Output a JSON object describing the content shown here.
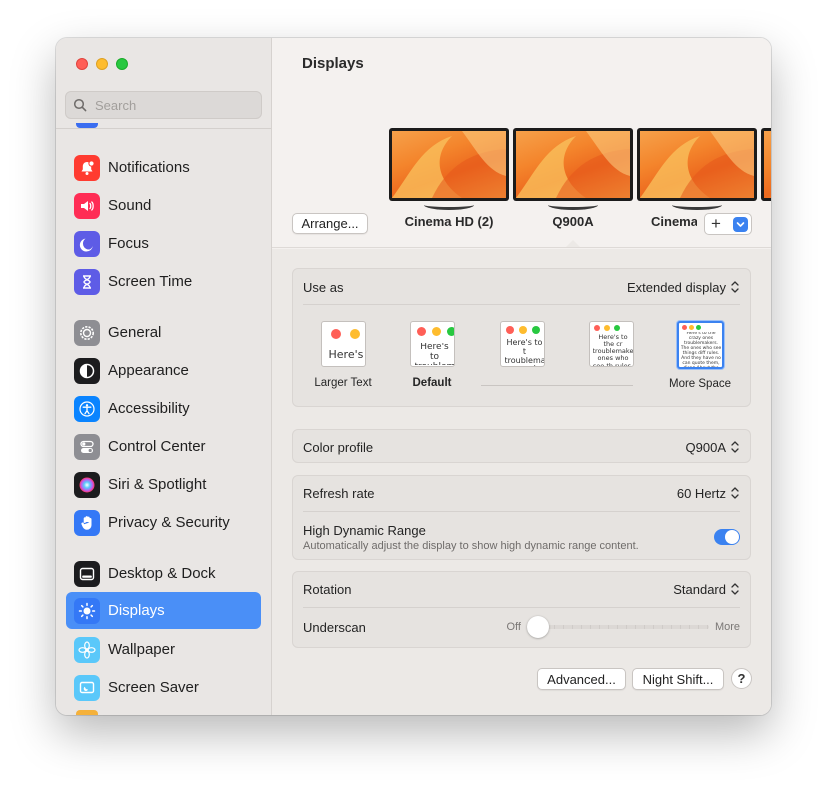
{
  "sidebar": {
    "search_placeholder": "Search",
    "items": [
      {
        "label": "Notifications",
        "icon": "bell-icon",
        "color": "#ff3b30"
      },
      {
        "label": "Sound",
        "icon": "speaker-icon",
        "color": "#ff2d55"
      },
      {
        "label": "Focus",
        "icon": "moon-icon",
        "color": "#5e5ce6"
      },
      {
        "label": "Screen Time",
        "icon": "hourglass-icon",
        "color": "#5e5ce6"
      },
      {
        "label": "General",
        "icon": "gear-icon",
        "color": "#8e8e93"
      },
      {
        "label": "Appearance",
        "icon": "appearance-icon",
        "color": "#1c1c1e"
      },
      {
        "label": "Accessibility",
        "icon": "accessibility-icon",
        "color": "#0a84ff"
      },
      {
        "label": "Control Center",
        "icon": "toggles-icon",
        "color": "#8e8e93"
      },
      {
        "label": "Siri & Spotlight",
        "icon": "siri-icon",
        "color": "#1c1c1e"
      },
      {
        "label": "Privacy & Security",
        "icon": "hand-icon",
        "color": "#3478f6"
      },
      {
        "label": "Desktop & Dock",
        "icon": "dock-icon",
        "color": "#1c1c1e"
      },
      {
        "label": "Displays",
        "icon": "sun-icon",
        "color": "#3478f6",
        "active": true
      },
      {
        "label": "Wallpaper",
        "icon": "flower-icon",
        "color": "#5ac8fa"
      },
      {
        "label": "Screen Saver",
        "icon": "screensaver-icon",
        "color": "#5ac8fa"
      }
    ]
  },
  "main": {
    "title": "Displays",
    "arrange_label": "Arrange...",
    "displays": [
      {
        "label": "Cinema HD (2)"
      },
      {
        "label": "Q900A",
        "selected": true
      },
      {
        "label": "Cinema"
      }
    ],
    "add_display_symbol": "+",
    "use_as": {
      "label": "Use as",
      "value": "Extended display"
    },
    "resolutions": [
      {
        "label": "Larger Text",
        "sample": "Here's"
      },
      {
        "label": "Default",
        "sample": "Here's to troublem",
        "bold": true
      },
      {
        "label": "",
        "sample": "Here's to t troublema ones who"
      },
      {
        "label": "",
        "sample": "Here's to the cr troublemakers. ones who see th rules. And they"
      },
      {
        "label": "More Space",
        "sample": "Here's to the crazy ones troublemakers. The ones who see things diff rules. And they have no can quote them, disag About the only thing yo because they change th",
        "selected": true
      }
    ],
    "color_profile": {
      "label": "Color profile",
      "value": "Q900A"
    },
    "refresh_rate": {
      "label": "Refresh rate",
      "value": "60 Hertz"
    },
    "hdr": {
      "label": "High Dynamic Range",
      "description": "Automatically adjust the display to show high dynamic range content.",
      "enabled": true
    },
    "rotation": {
      "label": "Rotation",
      "value": "Standard"
    },
    "underscan": {
      "label": "Underscan",
      "min_label": "Off",
      "max_label": "More",
      "value": 0
    },
    "advanced_label": "Advanced...",
    "night_shift_label": "Night Shift...",
    "help_label": "?"
  }
}
